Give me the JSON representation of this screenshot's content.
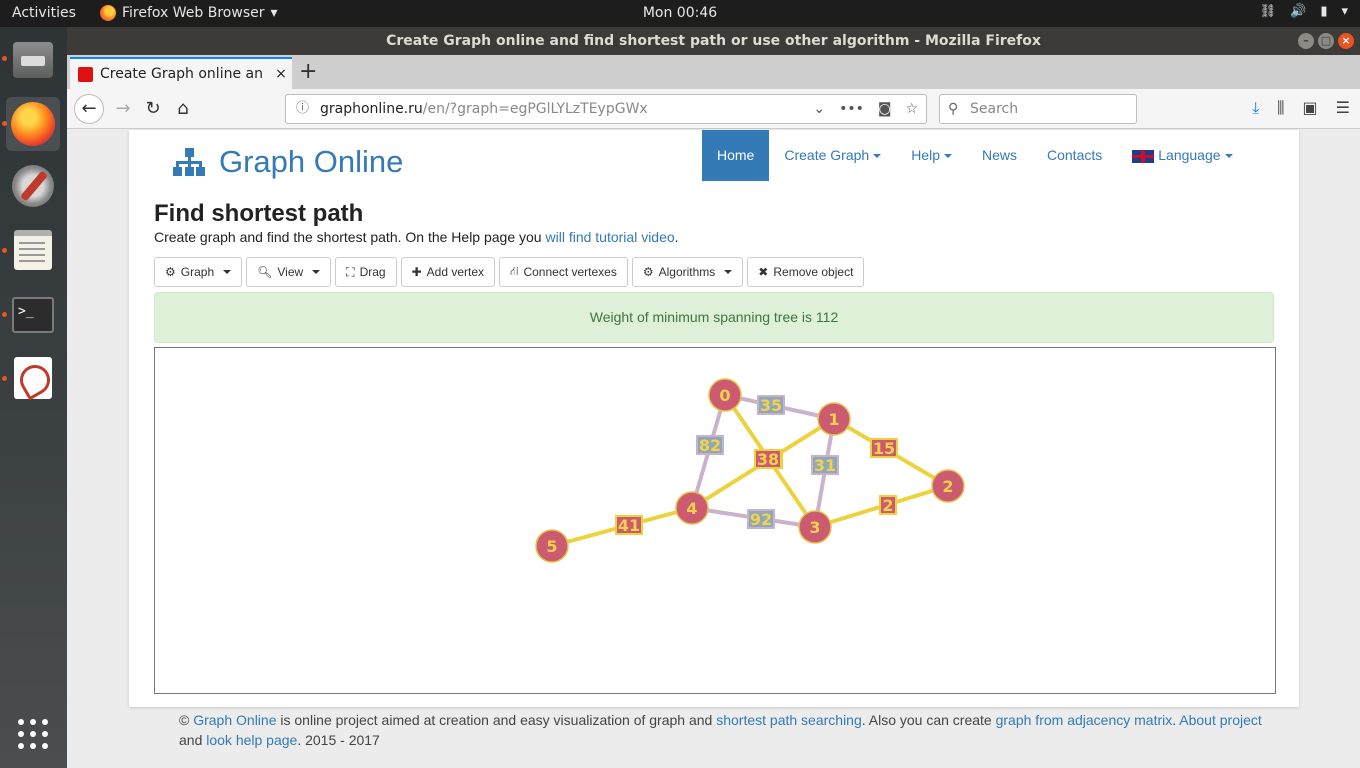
{
  "system": {
    "activities": "Activities",
    "app_menu": "Firefox Web Browser",
    "clock": "Mon 00:46"
  },
  "window": {
    "title": "Create Graph online and find shortest path or use other algorithm - Mozilla Firefox"
  },
  "tab": {
    "label": "Create Graph online and",
    "close": "×"
  },
  "url": {
    "host": "graphonline.ru",
    "path": "/en/?graph=egPGlLYLzTEypGWx"
  },
  "search": {
    "placeholder": "Search"
  },
  "site": {
    "brand": "Graph Online",
    "nav": [
      {
        "label": "Home",
        "active": true
      },
      {
        "label": "Create Graph",
        "dropdown": true
      },
      {
        "label": "Help",
        "dropdown": true
      },
      {
        "label": "News"
      },
      {
        "label": "Contacts"
      },
      {
        "label": "Language",
        "dropdown": true
      }
    ]
  },
  "page": {
    "heading": "Find shortest path",
    "subtitle_text": "Create graph and find the shortest path. On the Help page you ",
    "subtitle_link": "will find tutorial video",
    "subtitle_end": "."
  },
  "toolbar": {
    "graph": "Graph",
    "view": "View",
    "drag": "Drag",
    "add_vertex": "Add vertex",
    "connect": "Connect vertexes",
    "algorithms": "Algorithms",
    "remove": "Remove object"
  },
  "alert": {
    "message": "Weight of minimum spanning tree is 112"
  },
  "graph": {
    "colors": {
      "vertex_fill": "#cc5a71",
      "vertex_stroke": "#e6c24a",
      "vertex_text": "#f2d24b",
      "edge_plain": "#c9b3cc",
      "edge_mst": "#ecd23c",
      "label_plain_fill": "#8fa7b8",
      "label_mst_fill": "#cc5a71"
    },
    "vertices": [
      "0",
      "1",
      "2",
      "3",
      "4",
      "5"
    ],
    "edges": [
      {
        "from": "0",
        "to": "1",
        "weight": "35",
        "mst": false
      },
      {
        "from": "0",
        "to": "4",
        "weight": "82",
        "mst": false
      },
      {
        "from": "0",
        "to": "3",
        "weight": "38",
        "mst": true
      },
      {
        "from": "1",
        "to": "4",
        "weight": "38",
        "mst": true
      },
      {
        "from": "1",
        "to": "2",
        "weight": "15",
        "mst": true
      },
      {
        "from": "1",
        "to": "3",
        "weight": "31",
        "mst": false
      },
      {
        "from": "3",
        "to": "2",
        "weight": "2",
        "mst": true
      },
      {
        "from": "4",
        "to": "3",
        "weight": "92",
        "mst": false
      },
      {
        "from": "5",
        "to": "4",
        "weight": "41",
        "mst": true
      }
    ]
  },
  "footer": {
    "c": "© ",
    "link1": "Graph Online",
    "t1": " is online project aimed at creation and easy visualization of graph and ",
    "link2": "shortest path searching",
    "t2": ". Also you can create ",
    "link3": "graph from adjacency matrix",
    "t3": ". ",
    "link4": "About project",
    "t4": " and ",
    "link5": "look help page",
    "t5": ". 2015 - 2017"
  }
}
